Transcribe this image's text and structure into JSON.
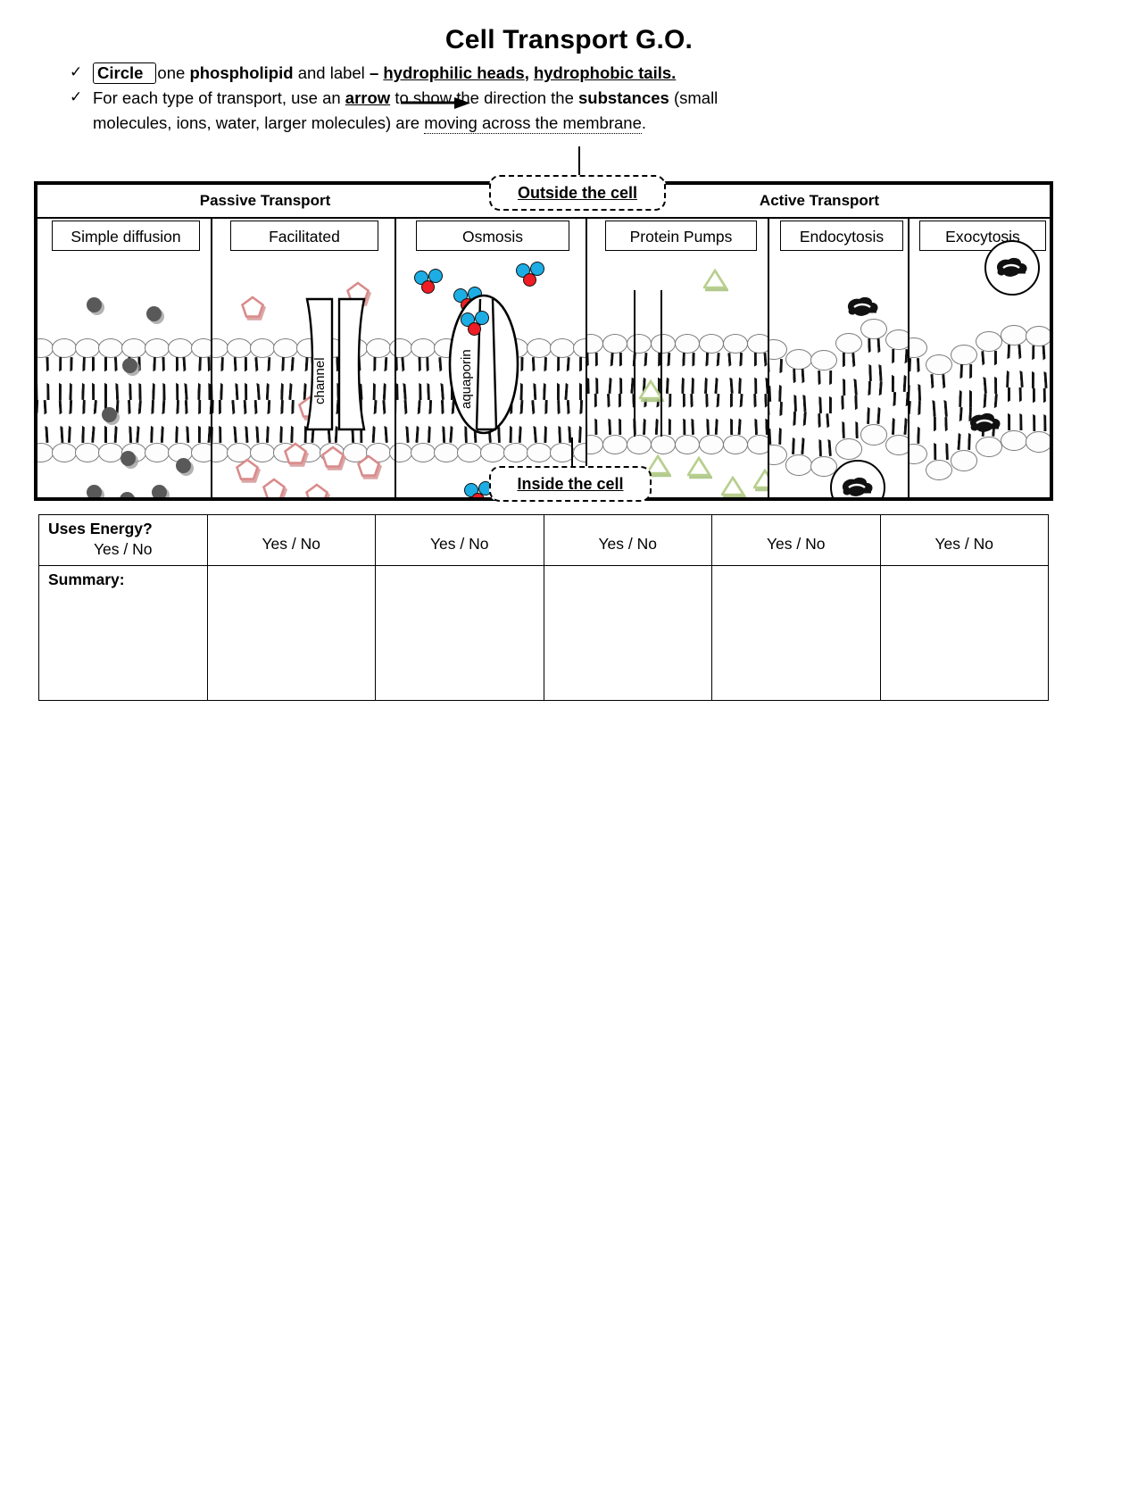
{
  "page": {
    "title": "Cell Transport G.O."
  },
  "instructions": [
    {
      "check": "✓",
      "boxed_word": "Circle",
      "part1": "one ",
      "bold1": "phospholipid",
      "part2": " and label ",
      "dash": "– ",
      "bold_u1": "hydrophilic heads",
      "comma": ", ",
      "bold_u2": "hydrophobic tails."
    },
    {
      "check": "✓",
      "part1": "For each type of transport, use an ",
      "arrow_word": "arrow",
      "part2": " to show the direction the ",
      "bold1": "substances",
      "part3": " (small",
      "line2a": "molecules, ions, water, larger molecules) are ",
      "line2b": "moving across the membrane",
      "line2c": "."
    }
  ],
  "diagram": {
    "categories": [
      {
        "label": "Passive Transport"
      },
      {
        "label": "Active Transport"
      }
    ],
    "callouts": {
      "outside": "Outside the cell",
      "inside": "Inside the cell"
    },
    "columns": [
      {
        "header": "Simple diffusion",
        "protein_label": ""
      },
      {
        "header": "Facilitated",
        "protein_label": "channel"
      },
      {
        "header": "Osmosis",
        "protein_label": "aquaporin"
      },
      {
        "header": "Protein Pumps",
        "protein_label": ""
      },
      {
        "header": "Endocytosis",
        "protein_label": ""
      },
      {
        "header": "Exocytosis",
        "protein_label": ""
      }
    ],
    "colors": {
      "solute_dot": "#595959",
      "pentagon_molecule": "#d98b8b",
      "triangle_molecule": "#b8cf8e",
      "water_oxygen": "#ee1c24",
      "water_hydrogen": "#1cade4",
      "lipid_head_outline": "#7b7b7b",
      "lipid_tail": "#111111",
      "frame": "#000000"
    }
  },
  "table": {
    "row_labels": {
      "energy": "Uses Energy?",
      "summary": "Summary:"
    },
    "energy_values": [
      "Yes / No",
      "Yes / No",
      "Yes / No",
      "Yes / No",
      "Yes / No",
      "Yes / No"
    ],
    "summary_values": [
      "",
      "",
      "",
      "",
      "",
      ""
    ]
  }
}
